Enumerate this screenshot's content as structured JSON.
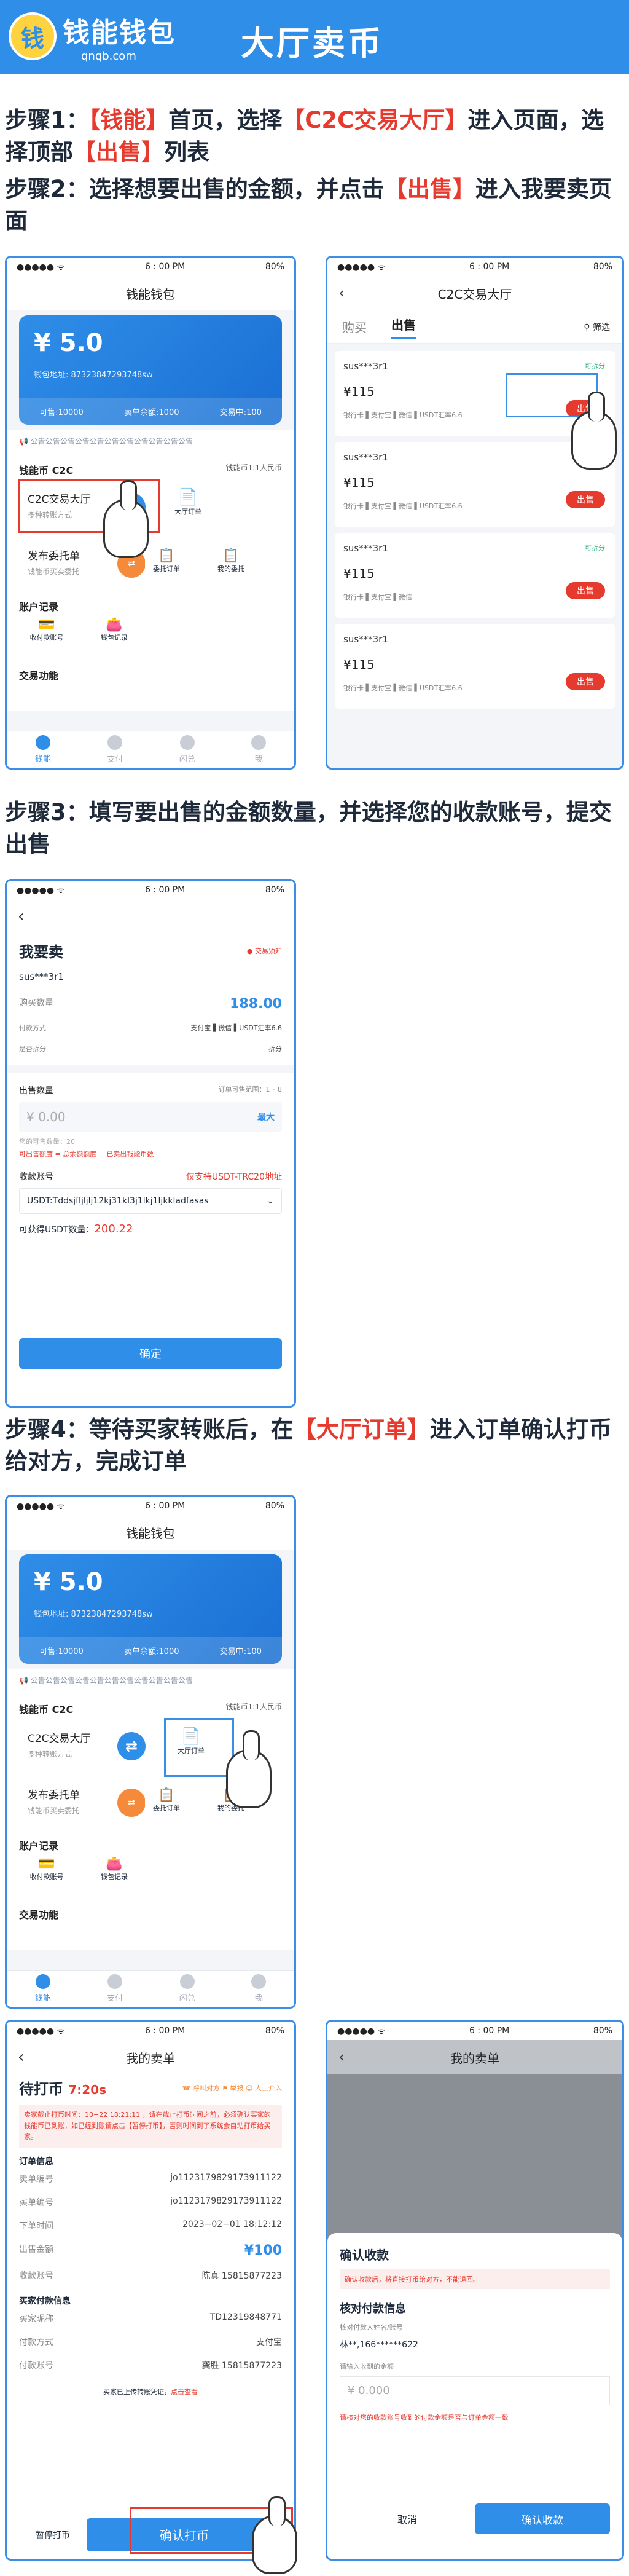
{
  "header": {
    "logo_text": "钱能钱包",
    "logo_sub": "qnqb.com",
    "title": "大厅卖币"
  },
  "steps": {
    "s1_a": "步骤1：",
    "s1_k1": "【钱能】",
    "s1_b": "首页，选择",
    "s1_k2": "【C2C交易大厅】",
    "s1_c": "进入页面，选择顶部",
    "s1_k3": "【出售】",
    "s1_d": "列表",
    "s2_a": "步骤2：选择想要出售的金额，并点击",
    "s2_k": "【出售】",
    "s2_b": "进入我要卖页面",
    "s3": "步骤3：填写要出售的金额数量，并选择您的收款账号，提交出售",
    "s4_a": "步骤4：等待买家转账后，在",
    "s4_k": "【大厅订单】",
    "s4_b": "进入订单确认打币给对方，完成订单"
  },
  "statusbar": {
    "carrier": "●●●●● ᯤ",
    "time": "6 : 00 PM",
    "battery": "80%"
  },
  "wallet": {
    "title": "钱能钱包",
    "amount": "¥ 5.0",
    "address": "钱包地址: 87323847293748sw",
    "available": "可售:10000",
    "seller_balance": "卖单余额:1000",
    "trades": "交易中:100",
    "notice": "公告公告公告公告公告公告公告公告公告公告公告",
    "section1": "钱能币 C2C",
    "rate": "钱能币1:1人民币",
    "c2c_title": "C2C交易大厅",
    "c2c_sub": "多种转账方式",
    "hall_orders": "大厅订单",
    "post_title": "发布委托单",
    "post_sub": "钱能币买卖委托",
    "entrust_orders": "委托订单",
    "my_entrust": "我的委托",
    "section2": "账户记录",
    "receive_acc": "收付款账号",
    "wallet_rec": "钱包记录",
    "section3": "交易功能",
    "tabs": [
      "钱能",
      "支付",
      "闪兑",
      "我"
    ]
  },
  "hall": {
    "title": "C2C交易大厅",
    "tab_buy": "购买",
    "tab_sell": "出售",
    "filter": "筛选",
    "orders": [
      {
        "user": "sus***3r1",
        "price": "¥115",
        "methods": "银行卡 ▌支付宝 ▌微信 ▌USDT汇率6.6",
        "tag": "可拆分",
        "btn": "出售"
      },
      {
        "user": "sus***3r1",
        "price": "¥115",
        "methods": "银行卡 ▌支付宝 ▌微信 ▌USDT汇率6.6",
        "tag": "",
        "btn": "出售"
      },
      {
        "user": "sus***3r1",
        "price": "¥115",
        "methods": "银行卡 ▌支付宝 ▌微信",
        "tag": "可拆分",
        "btn": "出售"
      },
      {
        "user": "sus***3r1",
        "price": "¥115",
        "methods": "银行卡 ▌支付宝 ▌微信 ▌USDT汇率6.6",
        "tag": "",
        "btn": "出售"
      }
    ]
  },
  "sell": {
    "title": "我要卖",
    "notice": "交易须知",
    "user": "sus***3r1",
    "qty_label": "购买数量",
    "qty": "188.00",
    "pay_label": "付款方式",
    "pay_vals": "支付宝 ▌微信 ▌USDT汇率6.6",
    "split_label": "是否拆分",
    "split_val": "拆分",
    "amount_label": "出售数量",
    "range": "订单可售范围：1 – 8",
    "amount_placeholder": "¥ 0.00",
    "max": "最大",
    "hint1": "您的可售数量：20",
    "hint2": "可出售额度 = 总余额额度 − 已卖出钱能币数",
    "account_label": "收款账号",
    "account_only": "仅支持USDT-TRC20地址",
    "account_val": "USDT:Tddsjfljljlj12kj31kl3j1lkj1ljkkladfasas",
    "usdt_label": "可获得USDT数量：",
    "usdt_val": "200.22",
    "confirm": "确定"
  },
  "order": {
    "title": "我的卖单",
    "status": "待打币",
    "timer": "7:20s",
    "icons": [
      "呼叫对方",
      "举报",
      "人工介入"
    ],
    "warn": "卖家截止打币时间：10−22 18:21:11 ，请在截止打币时间之前，必须确认买家的钱能币已到账，如已经到账请点击【暂停打币】，否则时间到了系统会自动打币给买家。",
    "info_title": "订单信息",
    "rows": [
      {
        "k": "卖单编号",
        "v": "jo1123179829173911122"
      },
      {
        "k": "买单编号",
        "v": "jo1123179829173911122"
      },
      {
        "k": "下单时间",
        "v": "2023−02−01 18:12:12"
      },
      {
        "k": "出售金额",
        "v": "¥100"
      },
      {
        "k": "收款账号",
        "v": "陈真 15815877223"
      }
    ],
    "buyer_title": "买家付款信息",
    "buyer_rows": [
      {
        "k": "买家昵称",
        "v": "TD12319848771"
      },
      {
        "k": "付款方式",
        "v": "支付宝"
      },
      {
        "k": "付款账号",
        "v": "龚胜 15815877223"
      }
    ],
    "proof": "买家已上传转账凭证，",
    "proof_link": "点击查看",
    "pause": "暂停打币",
    "confirm": "确认打币"
  },
  "confirm_dlg": {
    "title": "确认收款",
    "warn": "确认收款后，将直接打币给对方，不能退回。",
    "payer_title": "核对付款信息",
    "payer_label": "核对付款人姓名/账号",
    "payer_val": "林**,166******622",
    "amount_label": "请输入收到的金额",
    "amount_ph": "¥ 0.000",
    "tip": "请核对您的收款账号收到的付款金额是否与订单金额一致",
    "cancel": "取消",
    "ok": "确认收款"
  }
}
